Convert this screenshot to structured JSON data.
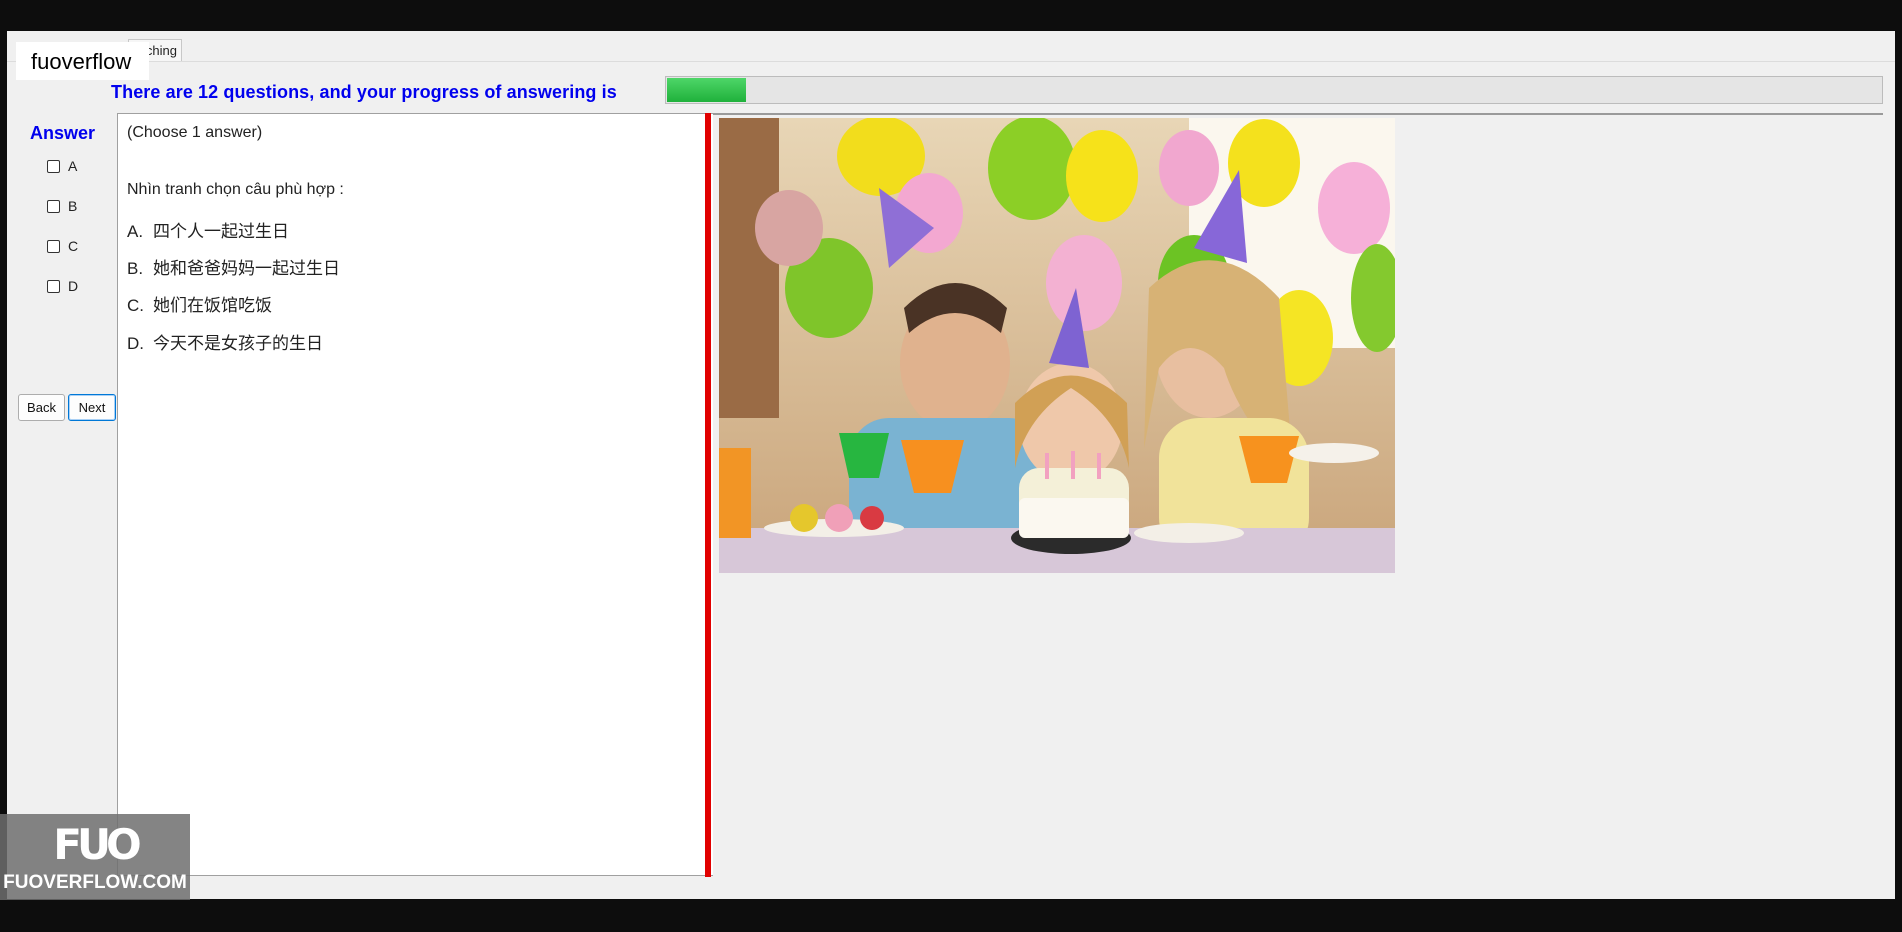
{
  "app": {
    "title": "fuoverflow"
  },
  "tab": {
    "label": "atching"
  },
  "progress": {
    "text": "There are 12 questions, and your progress of answering is",
    "fraction": 0.065,
    "color": "#2fbf4a"
  },
  "answer_panel": {
    "title": "Answer",
    "options": [
      "A",
      "B",
      "C",
      "D"
    ]
  },
  "navigation": {
    "back_label": "Back",
    "next_label": "Next"
  },
  "question": {
    "instruction": "(Choose 1 answer)",
    "prompt": "Nhìn tranh chọn câu phù hợp :",
    "choices": [
      {
        "letter": "A.",
        "text": "四个人一起过生日"
      },
      {
        "letter": "B.",
        "text": "她和爸爸妈妈一起过生日"
      },
      {
        "letter": "C.",
        "text": "她们在饭馆吃饭"
      },
      {
        "letter": "D.",
        "text": "今天不是女孩子的生日"
      }
    ]
  },
  "image": {
    "subject": "birthday-party-photo"
  },
  "watermark": {
    "logo": "FUO",
    "site": "FUOVERFLOW.COM"
  },
  "colors": {
    "accent_blue": "#0000ee",
    "splitter_red": "#e10000"
  }
}
